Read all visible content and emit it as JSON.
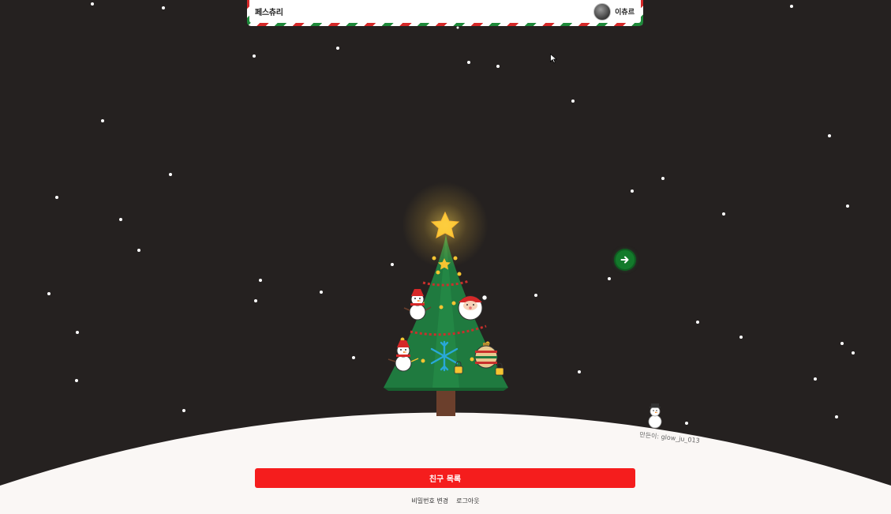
{
  "header": {
    "brand": "페스츄리",
    "username": "이츄르"
  },
  "credit": {
    "text": "만든이: glow_ju_013"
  },
  "actions": {
    "friends_button": "친구 목록",
    "change_password": "비밀번호 변경",
    "logout": "로그아웃"
  },
  "colors": {
    "background": "#252120",
    "snow": "#faf7f5",
    "accent_red": "#f51d1d",
    "tree_green": "#1f7a3f",
    "arrow_green": "#137a2b"
  },
  "icons": {
    "tree": "christmas-tree-icon",
    "star": "star-icon",
    "next": "arrow-right-icon",
    "snowman": "snowman-icon"
  }
}
